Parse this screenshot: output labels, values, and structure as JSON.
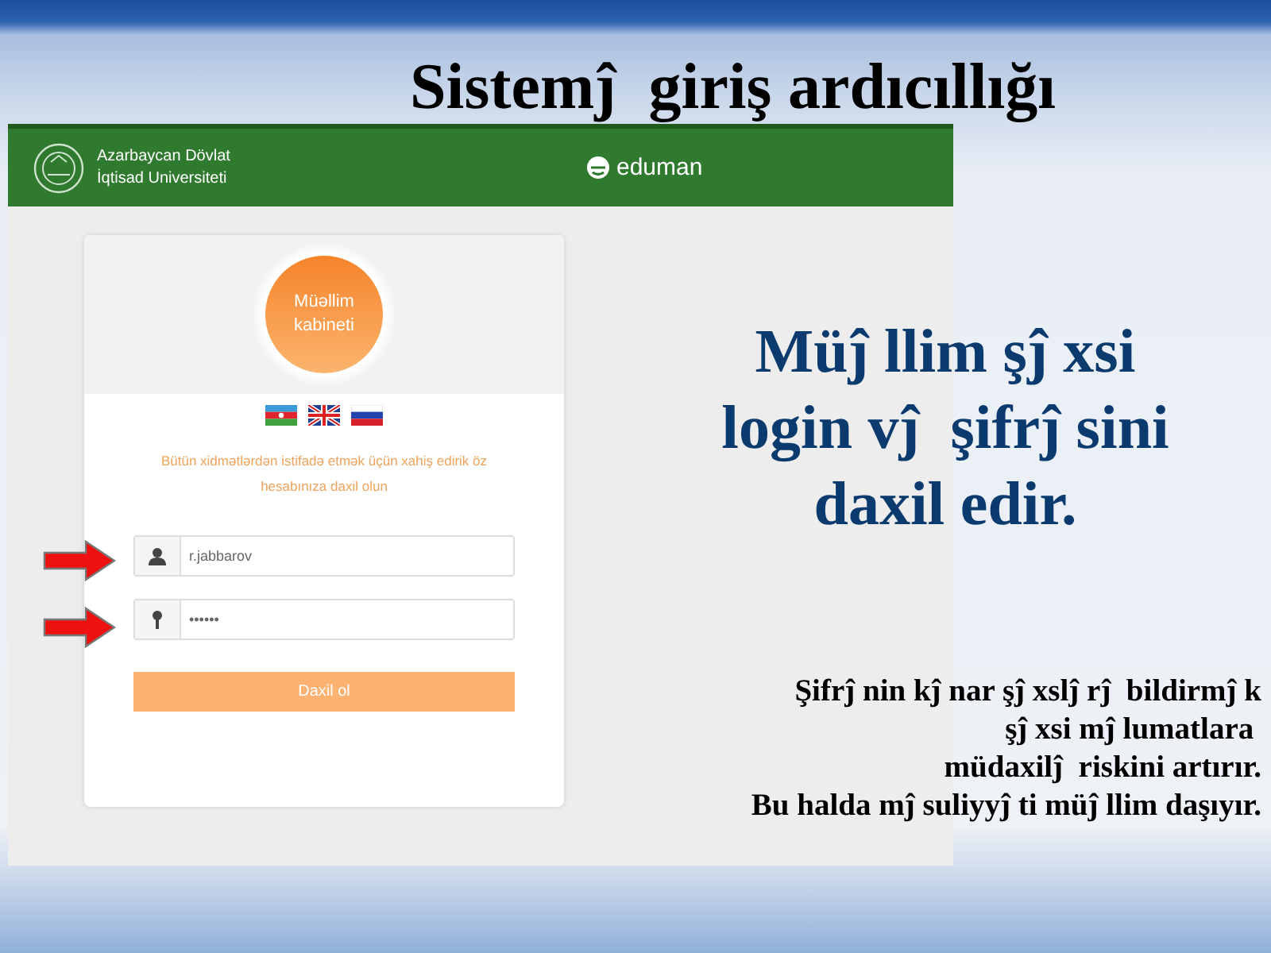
{
  "slide": {
    "title": "Sistemĵ  giriş ardıcıllığı"
  },
  "screenshot": {
    "header": {
      "university_lines": [
        "Azarbaycan Dövlat",
        "İqtisad Universiteti"
      ],
      "brand": "eduman"
    },
    "login_card": {
      "badge_lines": [
        "Müəllim",
        "kabineti"
      ],
      "notice": "Bütün xidmətlərdən istifadə etmək üçün xahiş edirik öz hesabınıza daxil olun",
      "fields": [
        {
          "kind": "user",
          "value": "r.jabbarov"
        },
        {
          "kind": "password",
          "value": "••••••"
        }
      ],
      "button": "Daxil ol"
    }
  },
  "callout": {
    "lines": [
      "Müĵ llim şĵ xsi",
      "login vĵ  şifrĵ sini",
      "daxil edir."
    ]
  },
  "note": {
    "lines": [
      "Şifrĵ nin kĵ nar şĵ xslĵ rĵ  bildirmĵ k",
      "şĵ xsi mĵ lumatlara ",
      "müdaxilĵ  riskini artırır.",
      "Bu halda mĵ suliyyĵ ti müĵ llim daşıyır."
    ]
  }
}
